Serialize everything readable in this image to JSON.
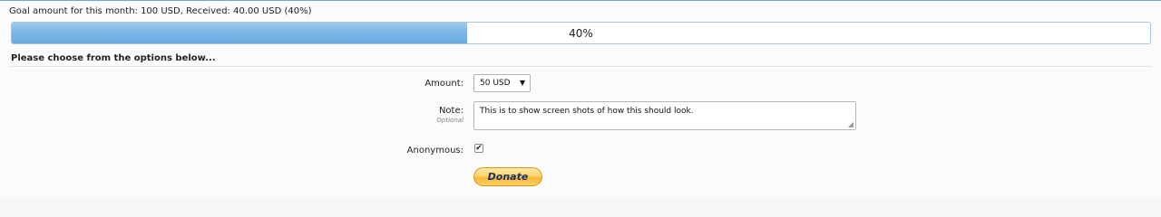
{
  "goal": {
    "summary": "Goal amount for this month: 100 USD, Received: 40.00 USD (40%)",
    "progress_fraction": 0.4,
    "progress_label": "40%"
  },
  "form": {
    "section_title": "Please choose from the options below...",
    "amount_label": "Amount:",
    "amount_selected": "50 USD",
    "note_label": "Note:",
    "note_sublabel": "Optional",
    "note_value": "This is to show screen shots of how this should look.",
    "anonymous_label": "Anonymous:",
    "anonymous_checked": true,
    "donate_label": "Donate"
  },
  "colors": {
    "progress_fill": "#7ab5e6",
    "accent_border": "#6aa7d6",
    "donate_text": "#1b2f6b"
  },
  "icons": {
    "select_caret": "caret-down-icon",
    "checkbox_mark": "check-icon",
    "resize_grip": "resize-grip-icon"
  }
}
